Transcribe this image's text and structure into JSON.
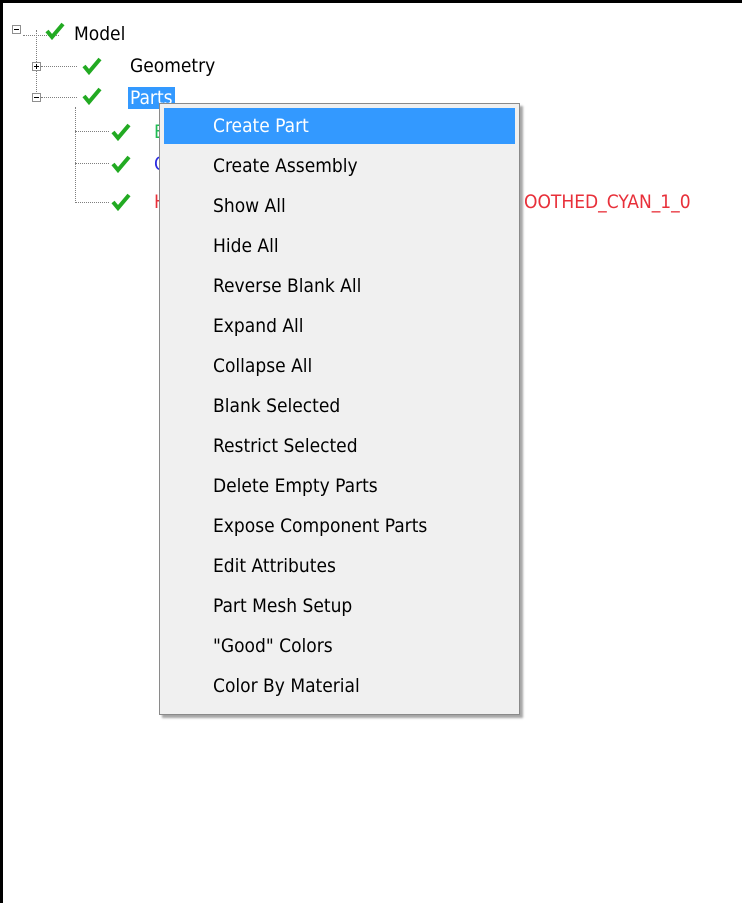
{
  "tree": {
    "root": {
      "label": "Model",
      "checked": true,
      "expanded": true
    },
    "geometry": {
      "label": "Geometry",
      "checked": true,
      "expanded": false
    },
    "parts": {
      "label": "Parts",
      "checked": true,
      "expanded": true,
      "selected": true
    },
    "children": [
      {
        "label": "B",
        "color": "#22bb55",
        "checked": true
      },
      {
        "label": "C",
        "color": "#2a2ae0",
        "checked": true
      },
      {
        "label": "H",
        "color": "#e8303a",
        "checked": true,
        "label_tail": "OOTHED_CYAN_1_0"
      }
    ]
  },
  "context_menu": {
    "items": [
      {
        "label": "Create Part",
        "selected": true
      },
      {
        "label": "Create Assembly"
      },
      {
        "label": "Show All"
      },
      {
        "label": "Hide All"
      },
      {
        "label": "Reverse Blank All"
      },
      {
        "label": "Expand All"
      },
      {
        "label": "Collapse All"
      },
      {
        "label": "Blank Selected"
      },
      {
        "label": "Restrict Selected"
      },
      {
        "label": "Delete Empty Parts"
      },
      {
        "label": "Expose Component Parts"
      },
      {
        "label": "Edit Attributes"
      },
      {
        "label": "Part Mesh Setup"
      },
      {
        "label": "\"Good\" Colors"
      },
      {
        "label": "Color By Material"
      }
    ]
  },
  "colors": {
    "selection": "#3399ff",
    "check": "#22aa22",
    "menu_bg": "#f0f0f0"
  },
  "icons": {
    "checkbox": "checked-checkbox-icon",
    "expand": "plus-expander-icon",
    "collapse": "minus-expander-icon"
  }
}
